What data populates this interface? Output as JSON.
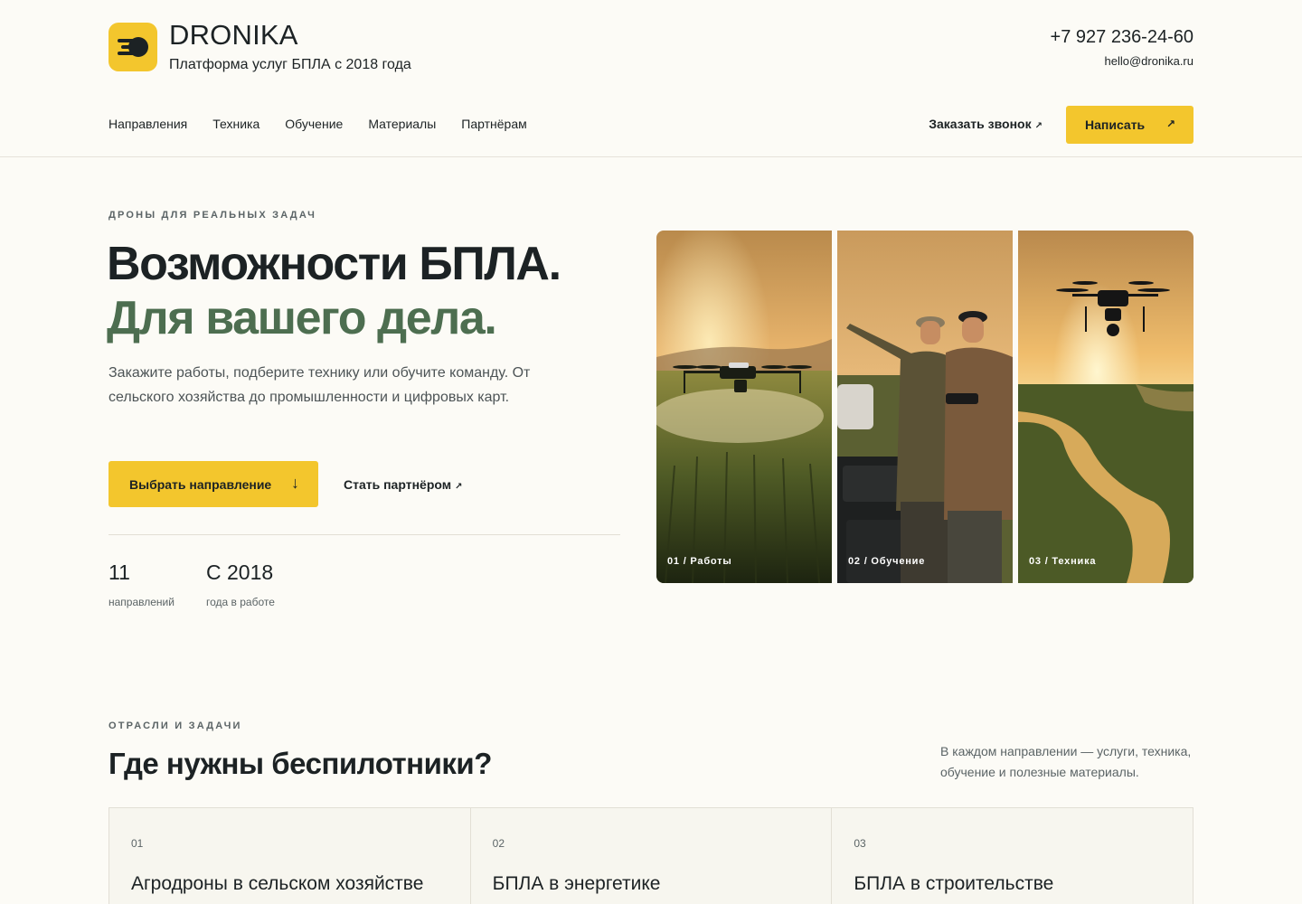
{
  "brand": {
    "name": "DRONIKA",
    "tagline": "Платформа услуг БПЛА с 2018 года",
    "logo_icon": "drone-logo-icon"
  },
  "contacts": {
    "phone": "+7 927 236-24-60",
    "email": "hello@dronika.ru"
  },
  "nav": {
    "items": [
      {
        "label": "Направления"
      },
      {
        "label": "Техника"
      },
      {
        "label": "Обучение"
      },
      {
        "label": "Материалы"
      },
      {
        "label": "Партнёрам"
      }
    ],
    "callback_label": "Заказать звонок",
    "write_label": "Написать"
  },
  "hero": {
    "eyebrow": "ДРОНЫ ДЛЯ РЕАЛЬНЫХ ЗАДАЧ",
    "title_line1": "Возможности БПЛА.",
    "title_line2": "Для вашего дела.",
    "description": "Закажите работы, подберите технику или обучите команду. От сельского хозяйства до промышленности и цифровых карт.",
    "primary_cta": "Выбрать направление",
    "secondary_cta": "Стать партнёром",
    "stats": [
      {
        "value": "11",
        "label": "направлений"
      },
      {
        "value": "С 2018",
        "label": "года в работе"
      }
    ],
    "panels": [
      {
        "caption": "01 / Работы"
      },
      {
        "caption": "02 / Обучение"
      },
      {
        "caption": "03 / Техника"
      }
    ]
  },
  "industries": {
    "eyebrow": "ОТРАСЛИ И ЗАДАЧИ",
    "title": "Где нужны беспилотники?",
    "note": "В каждом направлении — услуги, техника, обучение и полезные материалы.",
    "cards": [
      {
        "num": "01",
        "title": "Агродроны в сельском хозяйстве"
      },
      {
        "num": "02",
        "title": "БПЛА в энергетике"
      },
      {
        "num": "03",
        "title": "БПЛА в строительстве"
      }
    ]
  },
  "colors": {
    "accent": "#f3c62d",
    "green": "#4d6e50",
    "background": "#fcfbf6",
    "text": "#1c2224"
  }
}
